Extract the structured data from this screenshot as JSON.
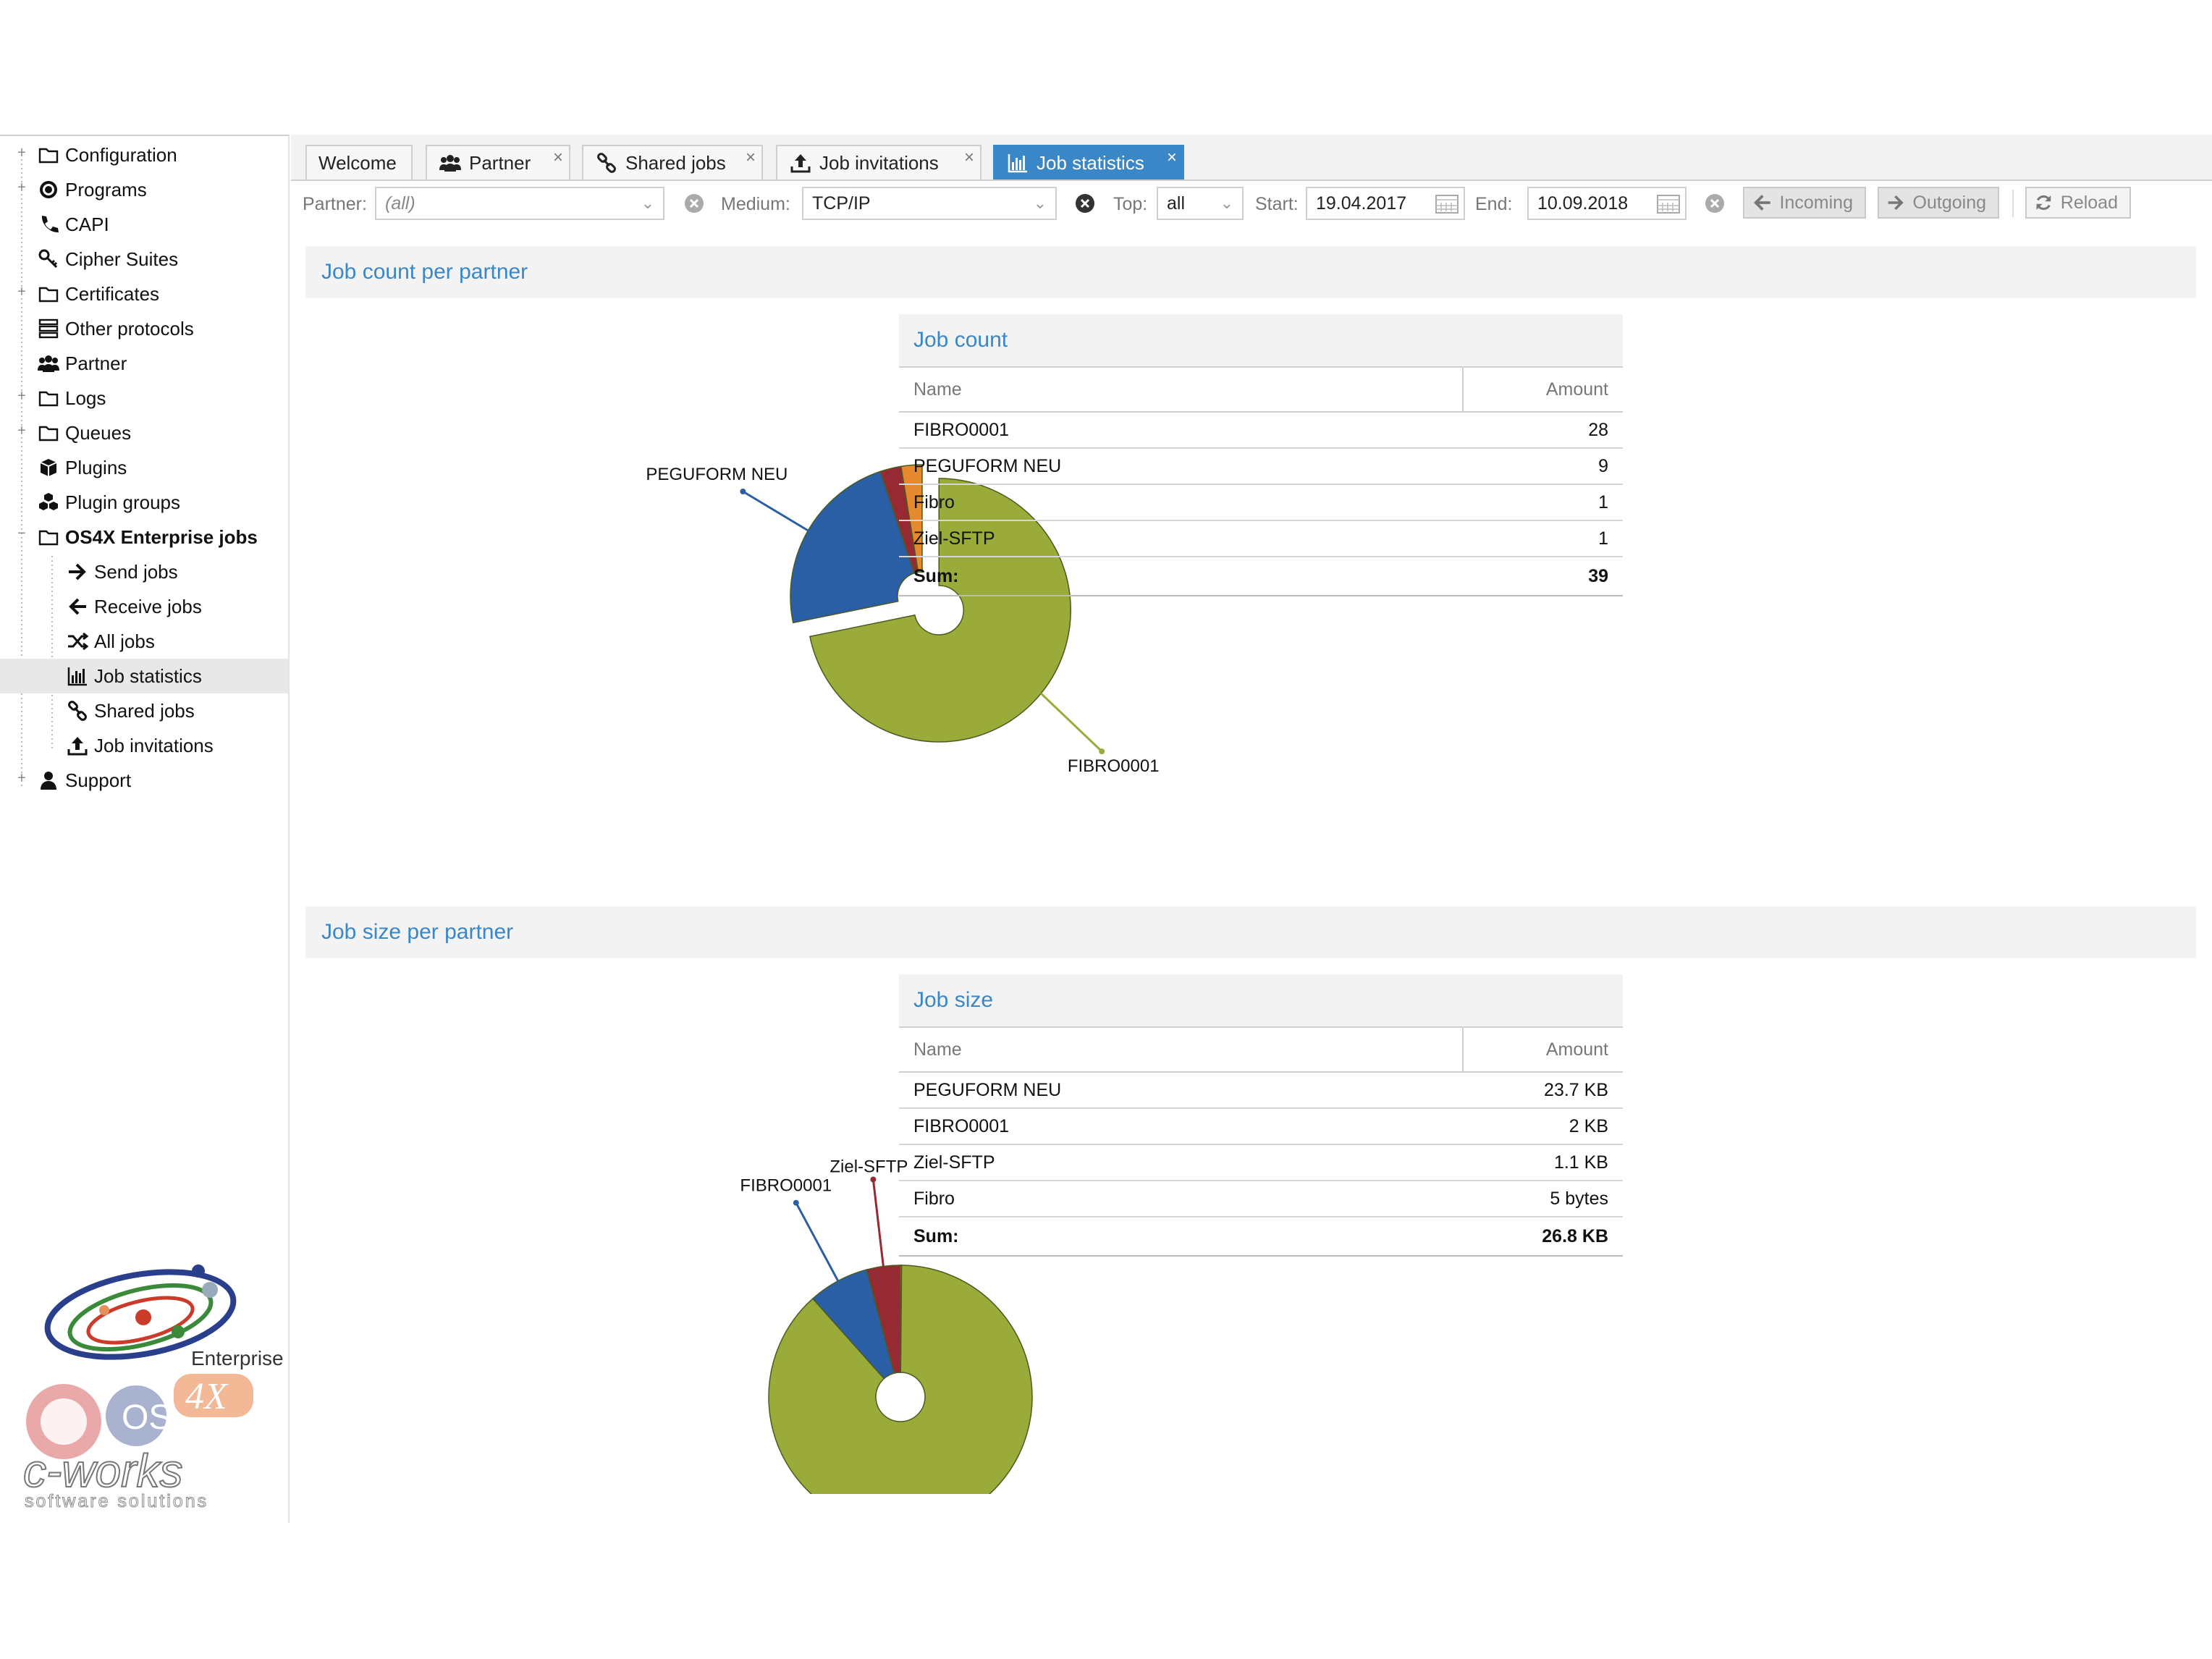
{
  "sidebar": {
    "items": [
      {
        "label": "Configuration",
        "icon": "folder-icon"
      },
      {
        "label": "Programs",
        "icon": "record-icon"
      },
      {
        "label": "CAPI",
        "icon": "phone-icon"
      },
      {
        "label": "Cipher Suites",
        "icon": "key-icon"
      },
      {
        "label": "Certificates",
        "icon": "folder-icon"
      },
      {
        "label": "Other protocols",
        "icon": "server-icon"
      },
      {
        "label": "Partner",
        "icon": "users-icon"
      },
      {
        "label": "Logs",
        "icon": "folder-icon"
      },
      {
        "label": "Queues",
        "icon": "folder-icon"
      },
      {
        "label": "Plugins",
        "icon": "cube-icon"
      },
      {
        "label": "Plugin groups",
        "icon": "cubes-icon"
      },
      {
        "label": "OS4X Enterprise jobs",
        "icon": "folder-icon"
      },
      {
        "label": "Send jobs",
        "icon": "arrow-right-icon"
      },
      {
        "label": "Receive jobs",
        "icon": "arrow-left-icon"
      },
      {
        "label": "All jobs",
        "icon": "shuffle-icon"
      },
      {
        "label": "Job statistics",
        "icon": "bar-chart-icon"
      },
      {
        "label": "Shared jobs",
        "icon": "link-icon"
      },
      {
        "label": "Job invitations",
        "icon": "upload-icon"
      },
      {
        "label": "Support",
        "icon": "user-icon"
      }
    ],
    "logo": {
      "edition": "Enterprise",
      "brand": "c-works",
      "tagline": "software solutions",
      "product_os": "OS",
      "product_4x": "4X"
    }
  },
  "tabs": [
    {
      "label": "Welcome"
    },
    {
      "label": "Partner"
    },
    {
      "label": "Shared jobs"
    },
    {
      "label": "Job invitations"
    },
    {
      "label": "Job statistics"
    }
  ],
  "toolbar": {
    "partner_label": "Partner:",
    "partner_value": "(all)",
    "medium_label": "Medium:",
    "medium_value": "TCP/IP",
    "top_label": "Top:",
    "top_value": "all",
    "start_label": "Start:",
    "start_value": "19.04.2017",
    "end_label": "End:",
    "end_value": "10.09.2018",
    "incoming_label": "Incoming",
    "outgoing_label": "Outgoing",
    "reload_label": "Reload"
  },
  "section_count": {
    "title": "Job count per partner",
    "table_title": "Job count",
    "col_name": "Name",
    "col_amount": "Amount",
    "rows": [
      {
        "name": "FIBRO0001",
        "amount": "28"
      },
      {
        "name": "PEGUFORM NEU",
        "amount": "9"
      },
      {
        "name": "Fibro",
        "amount": "1"
      },
      {
        "name": "Ziel-SFTP",
        "amount": "1"
      }
    ],
    "sum_label": "Sum:",
    "sum_value": "39"
  },
  "section_size": {
    "title": "Job size per partner",
    "table_title": "Job size",
    "col_name": "Name",
    "col_amount": "Amount",
    "rows": [
      {
        "name": "PEGUFORM NEU",
        "amount": "23.7 KB"
      },
      {
        "name": "FIBRO0001",
        "amount": "2 KB"
      },
      {
        "name": "Ziel-SFTP",
        "amount": "1.1 KB"
      },
      {
        "name": "Fibro",
        "amount": "5 bytes"
      }
    ],
    "sum_label": "Sum:",
    "sum_value": "26.8 KB"
  },
  "chart_data": [
    {
      "type": "pie",
      "title": "Job count per partner",
      "categories": [
        "FIBRO0001",
        "PEGUFORM NEU",
        "Fibro",
        "Ziel-SFTP"
      ],
      "values": [
        28,
        9,
        1,
        1
      ],
      "colors": [
        "#9aab3a",
        "#2a5fa5",
        "#962a32",
        "#e58a2e"
      ],
      "visible_labels": [
        "FIBRO0001",
        "PEGUFORM NEU"
      ]
    },
    {
      "type": "pie",
      "title": "Job size per partner",
      "categories": [
        "PEGUFORM NEU",
        "FIBRO0001",
        "Ziel-SFTP",
        "Fibro"
      ],
      "values": [
        23.7,
        2,
        1.1,
        0.005
      ],
      "colors": [
        "#9aab3a",
        "#2a5fa5",
        "#962a32",
        "#e58a2e"
      ],
      "visible_labels": [
        "PEGUFORM NEU",
        "FIBRO0001",
        "Ziel-SFTP"
      ]
    }
  ]
}
